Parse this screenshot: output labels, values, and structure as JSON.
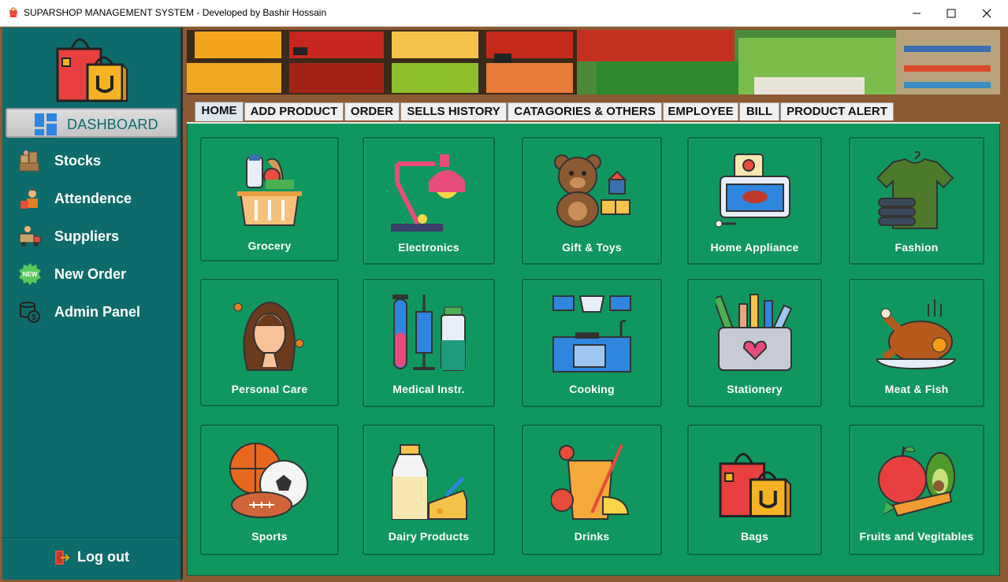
{
  "window": {
    "title": "SUPARSHOP MANAGEMENT SYSTEM  - Developed by Bashir Hossain"
  },
  "sidebar": {
    "dashboard_label": "DASHBOARD",
    "items": [
      {
        "label": "Stocks",
        "icon": "stocks-icon"
      },
      {
        "label": "Attendence",
        "icon": "attendence-icon"
      },
      {
        "label": "Suppliers",
        "icon": "suppliers-icon"
      },
      {
        "label": "New Order",
        "icon": "new-order-icon"
      },
      {
        "label": "Admin Panel",
        "icon": "admin-panel-icon"
      }
    ],
    "logout_label": "Log out"
  },
  "tabs": [
    {
      "label": "HOME",
      "active": true
    },
    {
      "label": "ADD PRODUCT"
    },
    {
      "label": "ORDER"
    },
    {
      "label": "SELLS HISTORY"
    },
    {
      "label": "CATAGORIES & OTHERS"
    },
    {
      "label": "EMPLOYEE"
    },
    {
      "label": "BILL"
    },
    {
      "label": "PRODUCT ALERT"
    }
  ],
  "categories": [
    {
      "label": "Grocery",
      "icon": "grocery-basket-icon"
    },
    {
      "label": "Electronics",
      "icon": "desk-lamp-icon"
    },
    {
      "label": "Gift & Toys",
      "icon": "teddy-bear-icon"
    },
    {
      "label": "Home Appliance",
      "icon": "toaster-oven-icon"
    },
    {
      "label": "Fashion",
      "icon": "shirt-icon"
    },
    {
      "label": "Personal Care",
      "icon": "woman-face-icon"
    },
    {
      "label": "Medical Instr.",
      "icon": "medical-vials-icon"
    },
    {
      "label": "Cooking",
      "icon": "kitchen-icon"
    },
    {
      "label": "Stationery",
      "icon": "pencil-holder-icon"
    },
    {
      "label": "Meat & Fish",
      "icon": "roast-chicken-icon"
    },
    {
      "label": "Sports",
      "icon": "sports-balls-icon"
    },
    {
      "label": "Dairy Products",
      "icon": "milk-cheese-icon"
    },
    {
      "label": "Drinks",
      "icon": "juice-glass-icon"
    },
    {
      "label": "Bags",
      "icon": "shopping-bags-icon"
    },
    {
      "label": "Fruits and Vegitables",
      "icon": "fruits-vegetables-icon"
    }
  ],
  "colors": {
    "sidebar": "#0e6b6b",
    "content": "#10975f",
    "frame": "#8b5a33"
  }
}
